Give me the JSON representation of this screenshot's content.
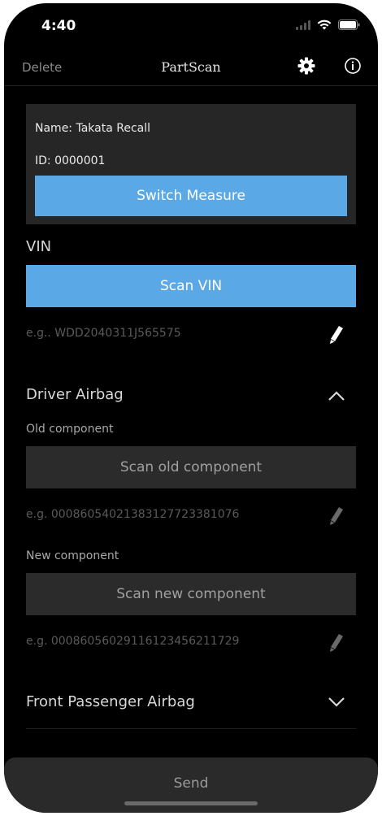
{
  "status": {
    "time": "4:40"
  },
  "nav": {
    "delete_label": "Delete",
    "title": "PartScan",
    "settings_icon": "gear-icon",
    "info_icon": "info-icon"
  },
  "card": {
    "name": "Name: Takata Recall",
    "id": "ID: 0000001",
    "switch_label": "Switch Measure"
  },
  "vin": {
    "label": "VIN",
    "scan_label": "Scan VIN",
    "placeholder": "e.g.. WDD2040311J565575"
  },
  "driver_airbag": {
    "title": "Driver Airbag",
    "old_label": "Old component",
    "old_scan_label": "Scan old component",
    "old_placeholder": "e.g. 00086054021383127723381076",
    "new_label": "New component",
    "new_scan_label": "Scan new component",
    "new_placeholder": "e.g. 00086056029116123456211729"
  },
  "front_passenger": {
    "title": "Front Passenger Airbag"
  },
  "footer": {
    "send_label": "Send"
  },
  "colors": {
    "accent": "#5aa8e6",
    "background": "#000000",
    "card": "#262626"
  }
}
